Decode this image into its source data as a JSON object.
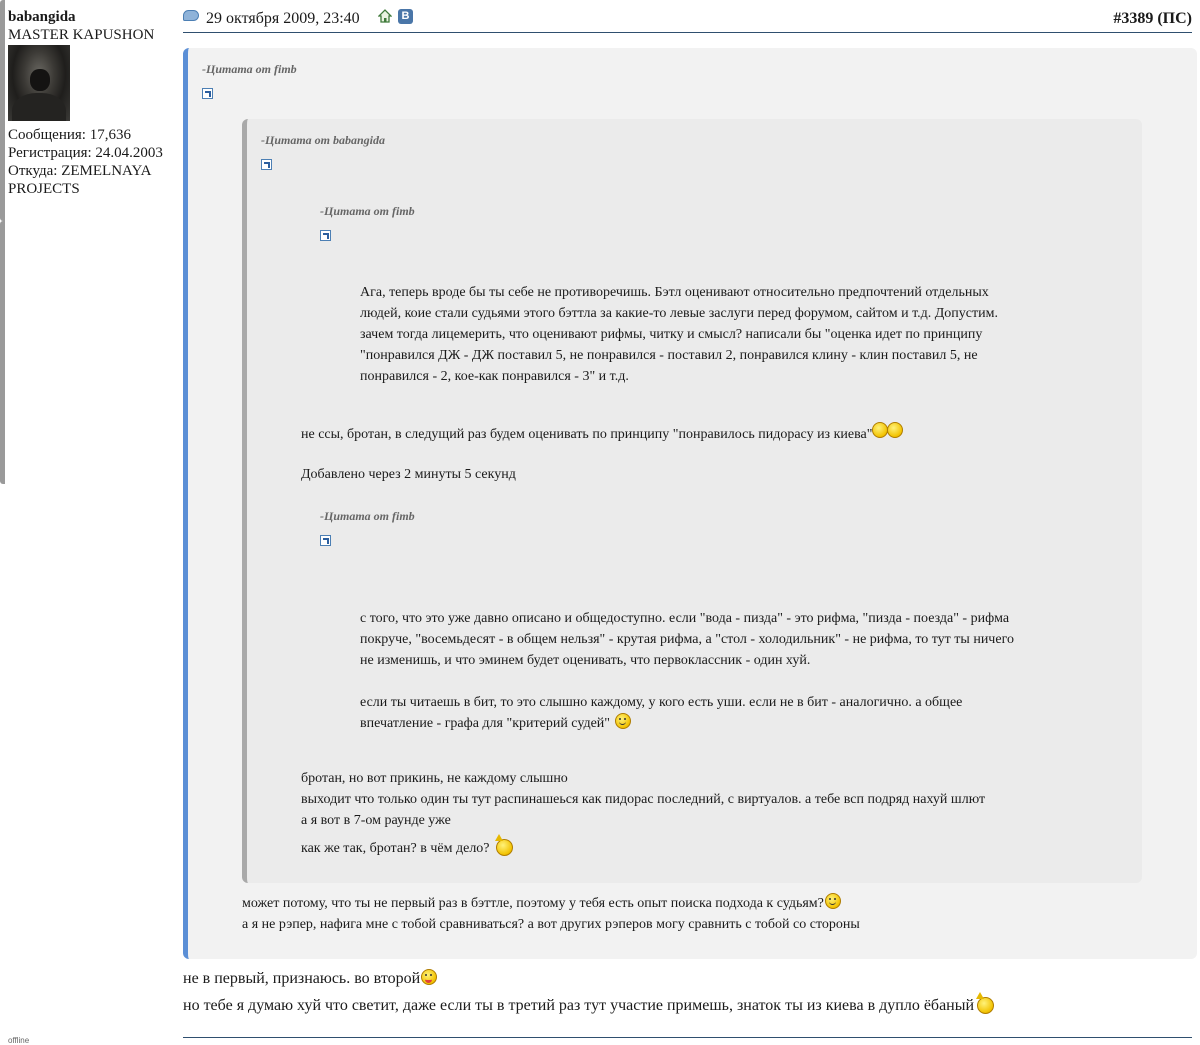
{
  "user": {
    "name": "babangida",
    "title": "MASTER KAPUSHON",
    "posts": "Сообщения: 17,636",
    "registered": "Регистрация: 24.04.2003",
    "from_line1": "Откуда: ZEMELNAYA",
    "from_line2": "PROJECTS",
    "status": "offline"
  },
  "post": {
    "date": "29 октября 2009, 23:40",
    "vk_label": "В",
    "number": "#3389",
    "ps": "(ПС)"
  },
  "quotes": {
    "q1_head": "-Цитата от fimb",
    "q2_head": "-Цитата от babangida",
    "q3_head": "-Цитата от fimb",
    "q4_head": "-Цитата от fimb",
    "q3_lines": [
      "Ага, теперь вроде бы ты себе не противоречишь. Бэтл оценивают относительно предпочтений отдельных",
      "людей, коие стали судьями этого бэттла за какие-то левые заслуги перед форумом, сайтом и т.д. Допустим.",
      "зачем тогда лицемерить, что оценивают рифмы, читку и смысл? написали бы \"оценка идет по принципу",
      "\"понравился ДЖ - ДЖ поставил 5, не понравился - поставил 2, понравился клину - клин поставил 5, не",
      "понравился - 2, кое-как понравился - 3\" и т.д."
    ],
    "q2_mid_line": "не ссы, бротан, в следущий раз будем оценивать по принципу \"понравилось пидорасу из киева\"",
    "q2_added": "Добавлено через 2 минуты 5 секунд",
    "q4_lines": [
      "с того, что это уже давно описано и общедоступно. если \"вода - пизда\" - это рифма, \"пизда - поезда\" - рифма",
      "покруче, \"восемьдесят - в общем нельзя\" - крутая рифма, а \"стол - холодильник\" - не рифма, то тут ты ничего",
      "не изменишь, и что эминем будет оценивать, что первоклассник - один хуй.",
      "если ты читаешь в бит, то это слышно каждому, у кого есть уши. если не в бит - аналогично. а общее",
      "впечатление - графа для \"критерий судей\""
    ],
    "q2_tail_lines": [
      "бротан, но вот прикинь, не каждому слышно",
      "выходит что только один ты тут распинашеься как пидорас последний, с виртуалов. а тебе всп подряд нахуй шлют",
      "а я вот в 7-ом раунде уже",
      "как же так, бротан? в чём дело?"
    ],
    "q1_tail_lines": [
      "может потому, что ты не первый раз в бэттле, поэтому у тебя есть опыт поиска подхода к судьям?",
      "а я не рэпер, нафига мне с тобой сравниваться? а вот других рэперов могу сравнить с тобой со стороны"
    ]
  },
  "body_lines": [
    "не в первый, признаюсь. во второй",
    "но тебе я думаю хуй что светит, даже если ты в третий раз тут участие примешь, знаток ты из киева в дупло ёбаный"
  ],
  "icons": [
    "post-bubble-icon",
    "home-icon",
    "vk-icon",
    "quote-link-icon",
    "smile-icon",
    "thumbs-up-icon",
    "crown-smile-icon",
    "tongue-smile-icon"
  ],
  "colors": {
    "quote_border_outer": "#5b8fd6",
    "quote_border_inner": "#a9a9a9",
    "quote_bg": "#f2f2f2",
    "link_blue": "#4a76a8"
  }
}
